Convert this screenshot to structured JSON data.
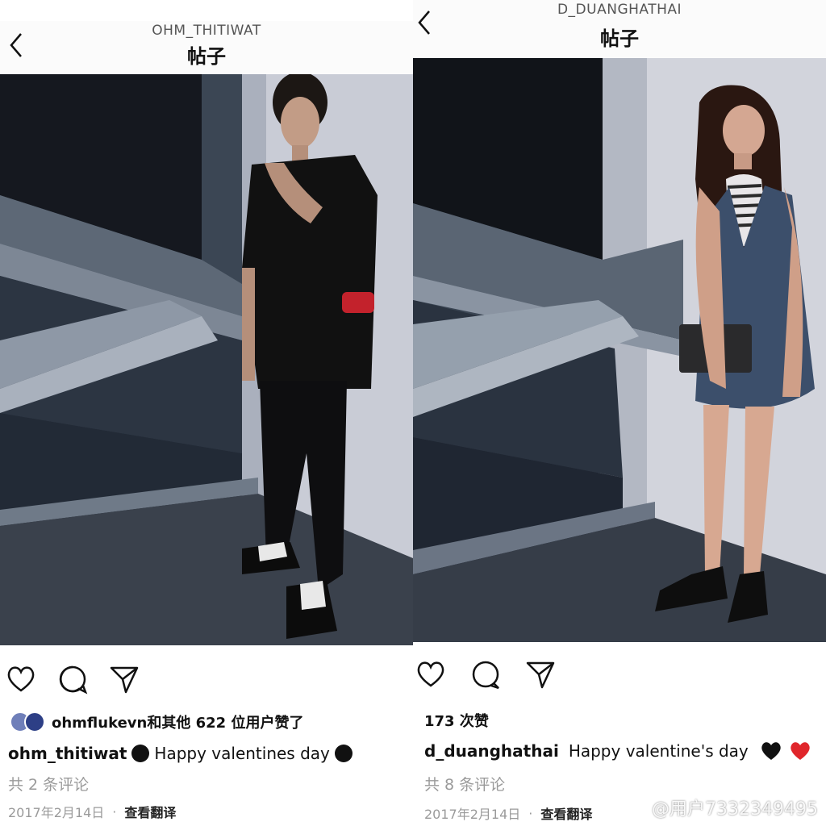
{
  "left_post": {
    "header": {
      "username": "OHM_THITIWAT",
      "title": "帖子"
    },
    "likes": {
      "text": "ohmflukevn和其他 622 位用户赞了"
    },
    "caption": {
      "username": "ohm_thitiwat",
      "text": "Happy valentines day"
    },
    "comments": {
      "text": "共 2 条评论"
    },
    "date": {
      "text": "2017年2月14日"
    },
    "translate": {
      "label": "查看翻译"
    },
    "dot": "·"
  },
  "right_post": {
    "header": {
      "username": "D_DUANGHATHAI",
      "title": "帖子"
    },
    "likes": {
      "text": "173 次赞"
    },
    "caption": {
      "username": "d_duanghathai",
      "text": "Happy valentine's day"
    },
    "comments": {
      "text": "共 8 条评论"
    },
    "date": {
      "text": "2017年2月14日"
    },
    "translate": {
      "label": "查看翻译"
    },
    "dot": "·"
  },
  "watermark": {
    "text": "@用户7332349495"
  },
  "icons": [
    "back-chevron-icon",
    "heart-icon",
    "comment-icon",
    "share-icon",
    "black-circle-emoji",
    "black-heart-emoji",
    "red-heart-emoji",
    "weibo-logo"
  ],
  "colors": {
    "accent_red": "#e0262b",
    "secondary_text": "#9a9a9a"
  }
}
